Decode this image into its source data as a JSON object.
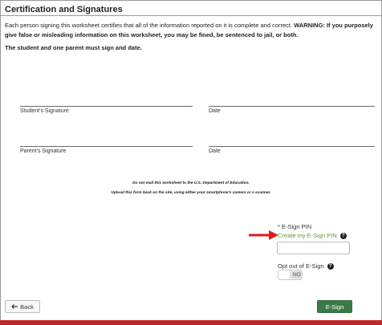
{
  "section_title": "Certification and Signatures",
  "certification": {
    "intro": "Each person signing this worksheet certifies that all of the information reported on it is complete and correct. ",
    "warning": "WARNING: If you purposely give false or misleading information on this worksheet, you may be fined, be sentenced to jail, or both."
  },
  "signing_requirement": "The student and one parent must sign and date.",
  "signatures": {
    "student_label": "Student's Signature",
    "student_date_label": "Date",
    "parent_label": "Parent's Signature",
    "parent_date_label": "Date"
  },
  "notes": {
    "do_not_mail": "Do not mail this worksheet to the U.S. Department of Education.",
    "upload": "Upload this form back on the site, using either your smartphone's camera or a scanner."
  },
  "esign": {
    "pin_label": "E-Sign PIN",
    "required_marker": "*",
    "create_pin_link": "Create my E-Sign PIN",
    "pin_value": "",
    "opt_out_label": "Opt out of E-Sign",
    "toggle_state": "NO"
  },
  "buttons": {
    "back_label": "Back",
    "esign_label": "E-Sign"
  },
  "colors": {
    "link_green": "#5a9d2a",
    "esign_button": "#3b7a47",
    "arrow_red": "#e01b1b",
    "footer_red": "#c0262b"
  }
}
